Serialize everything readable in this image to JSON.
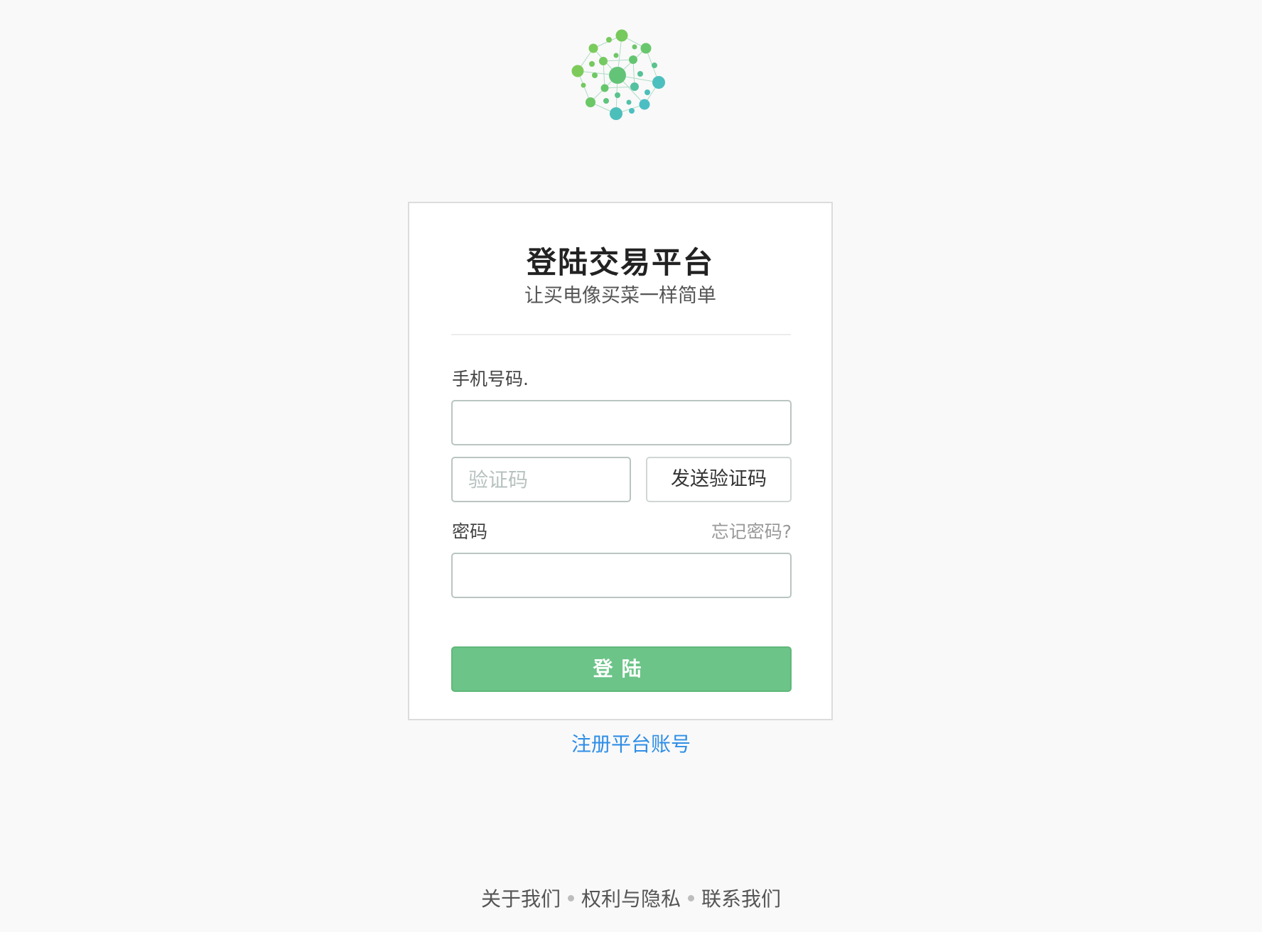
{
  "logo": {
    "icon": "network-dots-logo-icon",
    "colors": {
      "green": "#6cc36a",
      "teal": "#4cbfbf",
      "mid": "#5cc29a"
    }
  },
  "login": {
    "title": "登陆交易平台",
    "subtitle": "让买电像买菜一样简单",
    "phone_label": "手机号码.",
    "phone_value": "",
    "code_placeholder": "验证码",
    "code_value": "",
    "send_code_label": "发送验证码",
    "password_label": "密码",
    "forgot_label": "忘记密码?",
    "password_value": "",
    "submit_label": "登陆"
  },
  "register_label": "注册平台账号",
  "footer": {
    "links": [
      "关于我们",
      "权利与隐私",
      "联系我们"
    ]
  },
  "colors": {
    "background": "#f9f9f9",
    "primary_button": "#6cc488",
    "link": "#2f8ee6"
  }
}
